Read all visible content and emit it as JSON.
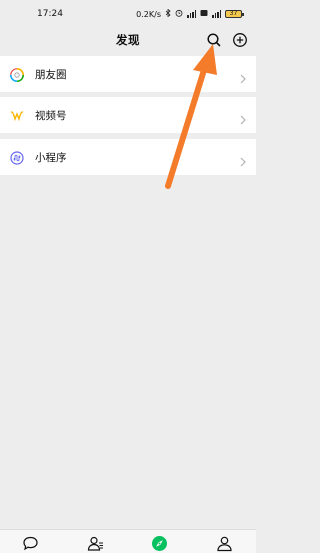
{
  "status_bar": {
    "time": "17:24",
    "speed": "0.2K/s",
    "battery": "37"
  },
  "nav_bar": {
    "title": "发现",
    "icons": [
      "search-icon",
      "add-icon"
    ]
  },
  "menu": {
    "items": [
      {
        "label": "朋友圈",
        "icon": "moments-icon"
      },
      {
        "label": "视频号",
        "icon": "channels-icon"
      },
      {
        "label": "小程序",
        "icon": "mini-programs-icon"
      }
    ]
  },
  "tab_bar": {
    "icons": [
      "chats-icon",
      "contacts-icon",
      "discover-icon",
      "me-icon"
    ],
    "active": "discover-icon",
    "active_color": "#07c160"
  },
  "annotation": {
    "color": "#f47b2a"
  }
}
